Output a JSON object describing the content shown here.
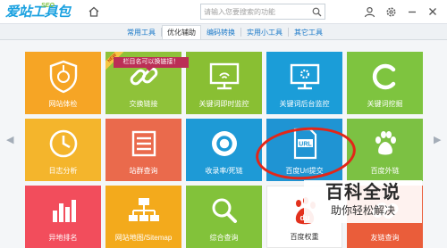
{
  "app": {
    "logo_text": "爱站工具包",
    "logo_seo": "SEO"
  },
  "search": {
    "placeholder": "请输入您要搜索的功能"
  },
  "tabs": [
    {
      "label": "常用工具",
      "active": false
    },
    {
      "label": "优化辅助",
      "active": true
    },
    {
      "label": "编码转换",
      "active": false
    },
    {
      "label": "实用小工具",
      "active": false
    },
    {
      "label": "其它工具",
      "active": false
    }
  ],
  "banner": "栏目名可以换链接！",
  "ribbon": "NEW",
  "tiles": [
    {
      "label": "网站体检",
      "color": "#f6a525",
      "icon": "shield-doctor-icon"
    },
    {
      "label": "交换链接",
      "color": "#8fc239",
      "icon": "chain-link-icon"
    },
    {
      "label": "关键词即时监控",
      "color": "#89bf33",
      "icon": "monitor-icon"
    },
    {
      "label": "关键词后台监控",
      "color": "#1b9dd8",
      "icon": "monitor-gear-icon"
    },
    {
      "label": "关键词挖掘",
      "color": "#7ec43f",
      "icon": "c-letter-icon"
    },
    {
      "label": "日志分析",
      "color": "#f4b52c",
      "icon": "clock-icon"
    },
    {
      "label": "站群查询",
      "color": "#ea6a4c",
      "icon": "list-icon"
    },
    {
      "label": "收录率/死链",
      "color": "#1e9ad6",
      "icon": "record-circle-icon"
    },
    {
      "label": "百度Url提交",
      "color": "#1f94d3",
      "icon": "url-document-icon"
    },
    {
      "label": "百度外链",
      "color": "#7cc143",
      "icon": "paw-icon"
    },
    {
      "label": "异地排名",
      "color": "#f24d5c",
      "icon": "bar-chart-icon"
    },
    {
      "label": "网站地图/Sitemap",
      "color": "#f3aa1c",
      "icon": "sitemap-icon"
    },
    {
      "label": "综合查询",
      "color": "#82c23a",
      "icon": "magnifier-icon"
    },
    {
      "label": "百度权重",
      "color": "#ffffff",
      "icon": "baidu-du-icon"
    },
    {
      "label": "友链查询",
      "color": "#ea5d3a",
      "icon": "link-icon"
    }
  ],
  "watermark": {
    "main": "百科全说",
    "sub": "助你轻松解决"
  }
}
